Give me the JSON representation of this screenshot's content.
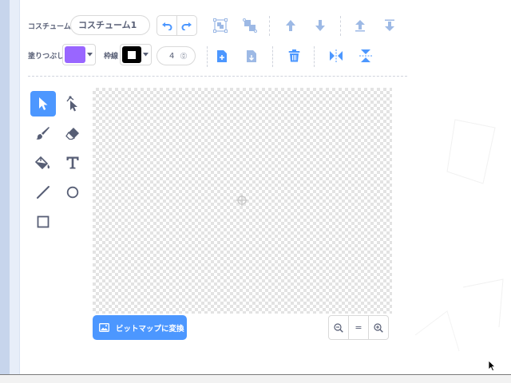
{
  "costume": {
    "label": "コスチューム",
    "name": "コスチューム1"
  },
  "fill": {
    "label": "塗りつぶし",
    "color": "#9966ff"
  },
  "outline": {
    "label": "枠線",
    "color": "#000000",
    "width": "4"
  },
  "convert_button": {
    "label": "ビットマップに変換"
  },
  "zoom": {
    "reset_label": "="
  },
  "colors": {
    "accent": "#4c97ff",
    "icon_disabled": "#c2d7f7",
    "text": "#575e75"
  },
  "toolbar_icons": [
    "undo-icon",
    "redo-icon",
    "group-icon",
    "ungroup-icon",
    "forward-icon",
    "backward-icon",
    "front-icon",
    "back-icon",
    "copy-icon",
    "paste-icon",
    "delete-icon",
    "flip-horizontal-icon",
    "flip-vertical-icon"
  ],
  "tools": [
    "select",
    "reshape",
    "brush",
    "eraser",
    "fill",
    "text",
    "line",
    "circle",
    "rectangle"
  ]
}
